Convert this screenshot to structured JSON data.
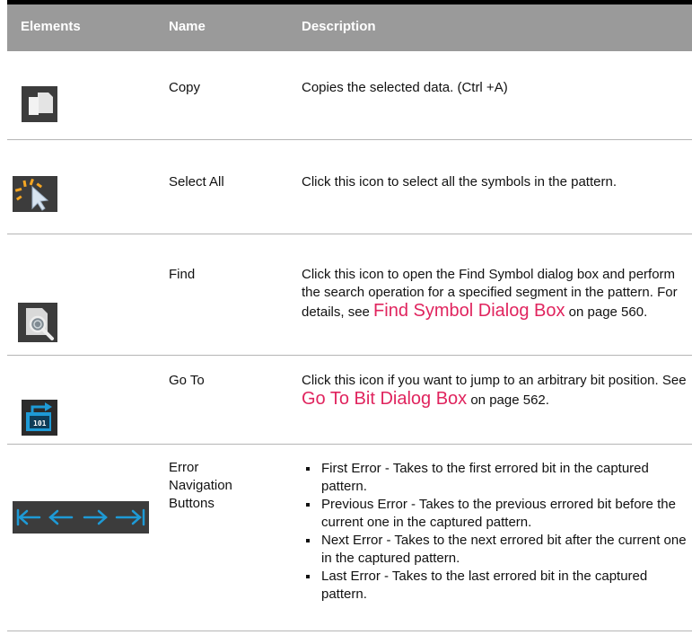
{
  "header": {
    "col_elements": "Elements",
    "col_name": "Name",
    "col_description": "Description"
  },
  "rows": [
    {
      "name": "Copy",
      "icon": "copy-icon",
      "desc": "Copies the selected data. (Ctrl +A)"
    },
    {
      "name": "Select All",
      "icon": "select-all-icon",
      "desc": "Click this icon to select all the symbols in the pattern."
    },
    {
      "name": "Find",
      "icon": "find-icon",
      "desc_a": "Click this icon to open the Find Symbol dialog box and perform the search operation for a specified segment in the pattern. For details, see ",
      "link": "Find Symbol Dialog Box",
      "desc_b": " on page 560."
    },
    {
      "name": "Go To",
      "icon": "go-to-bit-icon",
      "desc_a": "Click this icon if you want to jump to an arbitrary bit position. See ",
      "link": "Go To Bit Dialog Box",
      "desc_b": " on page 562."
    },
    {
      "name_1": "Error",
      "name_2": "Navigation",
      "name_3": "Buttons",
      "icon": "error-navigation-icons",
      "bullets": [
        "First Error - Takes to the first errored bit in the captured pattern.",
        "Previous Error - Takes to the previous errored bit before the current one in the captured pattern.",
        "Next Error - Takes to the next errored bit after the current one in the captured pattern.",
        "Last Error - Takes to the last errored bit in the captured pattern."
      ]
    }
  ],
  "colors": {
    "header_bg": "#9a9a9a",
    "link": "#e0245e",
    "icon_bg": "#3c3c3c",
    "accent_blue": "#1e9ad6"
  }
}
